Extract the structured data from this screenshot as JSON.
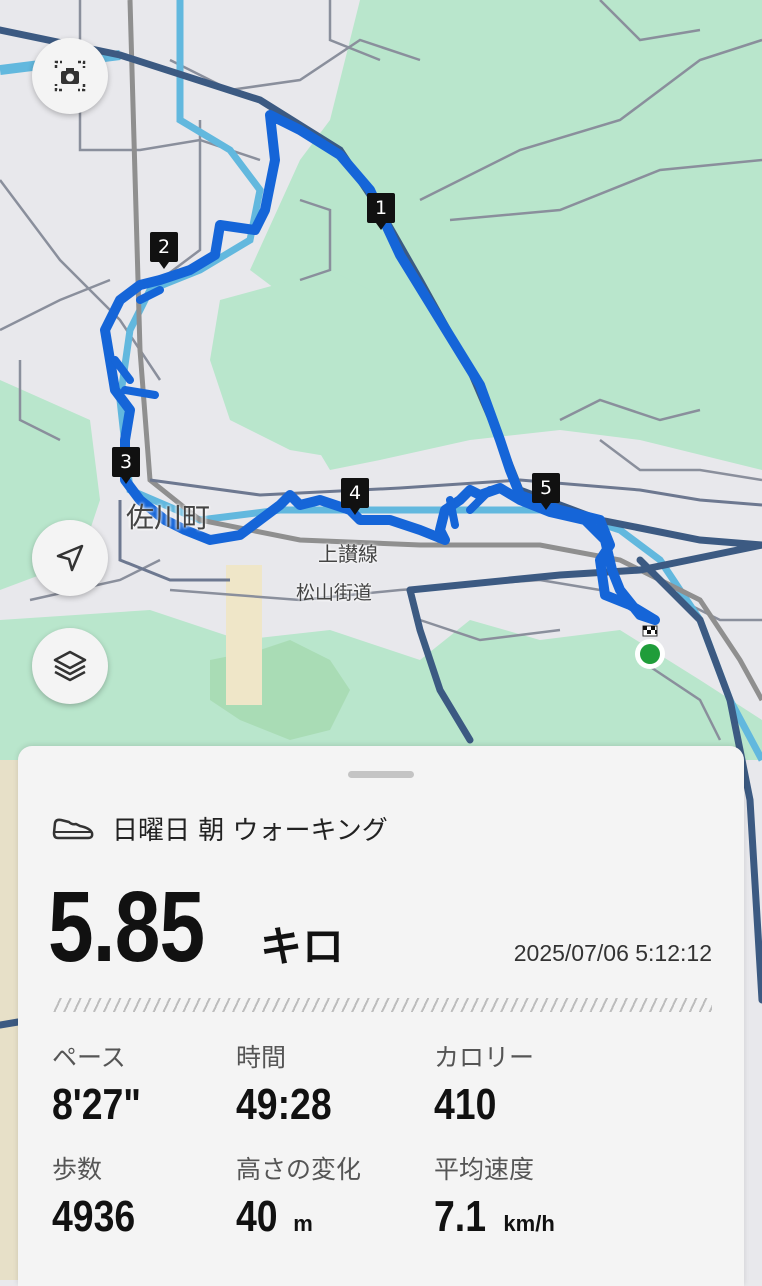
{
  "map": {
    "place_labels": [
      "佐川町",
      "上讃線",
      "松山街道"
    ],
    "split_markers": [
      "1",
      "2",
      "3",
      "4",
      "5"
    ],
    "colors": {
      "route": "#1565d8",
      "forest": "#b7e6cb",
      "road_major": "#3b5a80",
      "river": "#5bb7dc",
      "start": "#1f9d3a"
    }
  },
  "controls": {
    "screenshot_icon": "camera-screenshot-icon",
    "locate_icon": "navigation-arrow-icon",
    "layers_icon": "layers-icon"
  },
  "activity": {
    "type_icon": "shoe-icon",
    "title": "日曜日 朝 ウォーキング",
    "distance": "5.85",
    "distance_unit": "キロ",
    "datetime": "2025/07/06 5:12:12"
  },
  "stats": [
    {
      "label": "ペース",
      "value": "8'27\"",
      "unit": ""
    },
    {
      "label": "時間",
      "value": "49:28",
      "unit": ""
    },
    {
      "label": "カロリー",
      "value": "410",
      "unit": ""
    },
    {
      "label": "歩数",
      "value": "4936",
      "unit": ""
    },
    {
      "label": "高さの変化",
      "value": "40",
      "unit": "m"
    },
    {
      "label": "平均速度",
      "value": "7.1",
      "unit": "km/h"
    }
  ]
}
